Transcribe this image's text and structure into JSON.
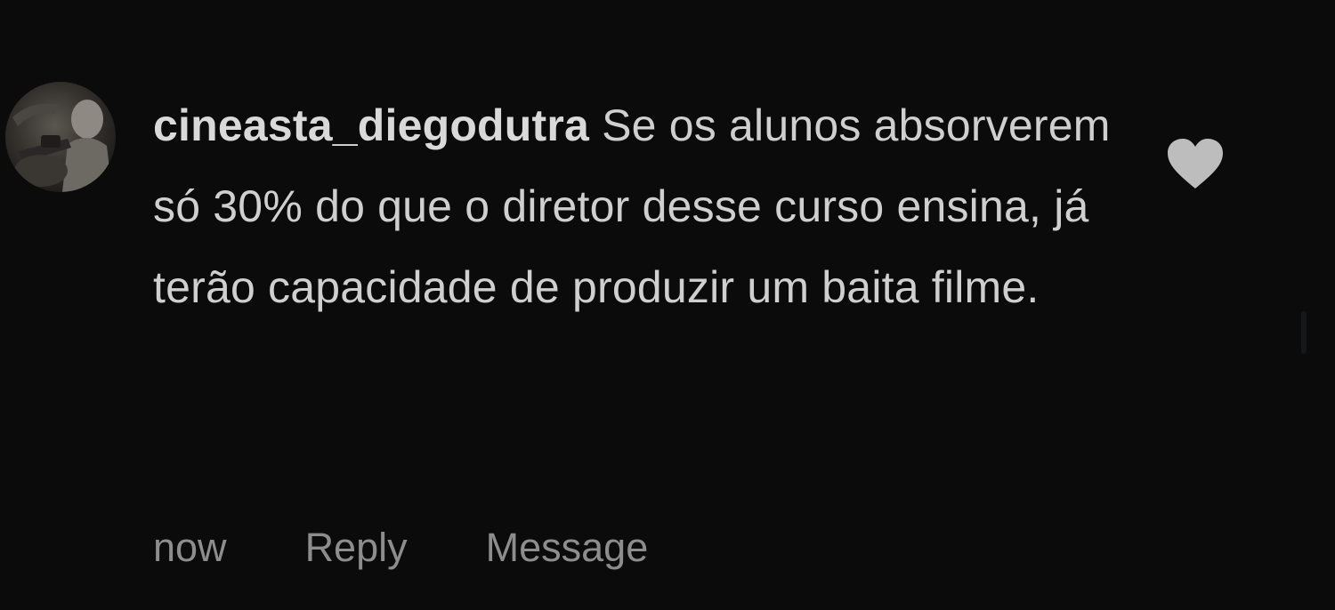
{
  "comment": {
    "username": "cineasta_diegodutra",
    "text": "Se os alunos absorverem só 30% do que o diretor desse curso ensina, já terão capacidade de produzir um baita filme.",
    "avatar_icon": "user-avatar-photo",
    "like_icon": "heart-icon",
    "colors": {
      "background": "#0b0b0c",
      "text": "#cfcfcf",
      "meta": "#8d8d8d",
      "heart": "#bdbdbd"
    }
  },
  "actions": {
    "time": "now",
    "reply": "Reply",
    "message": "Message"
  }
}
